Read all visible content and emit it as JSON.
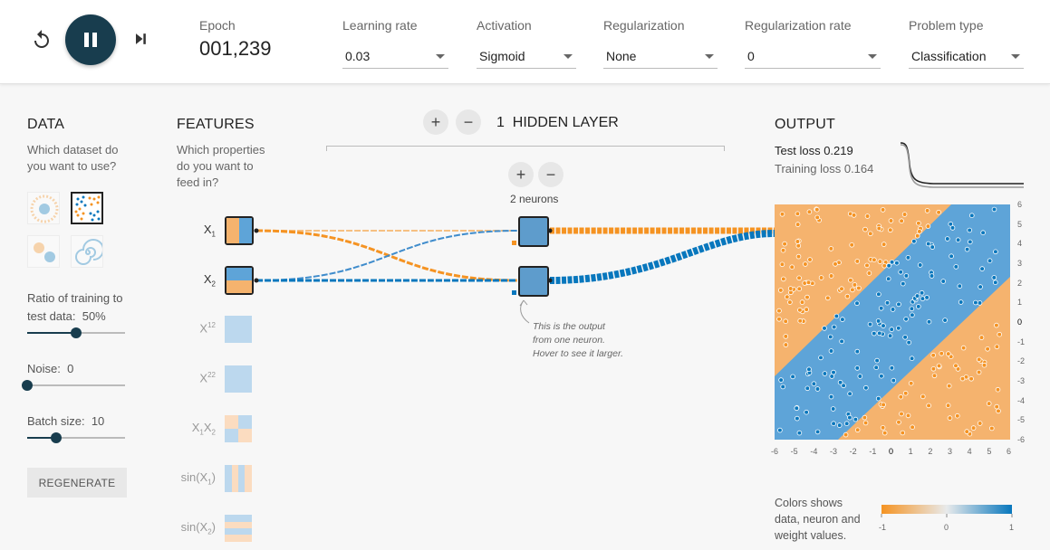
{
  "controls": {
    "reset_icon": "reset-icon",
    "pause_icon": "pause-icon",
    "step_icon": "step-forward-icon"
  },
  "epoch": {
    "label": "Epoch",
    "value": "001,239"
  },
  "dropdowns": [
    {
      "id": "learning-rate",
      "label": "Learning rate",
      "value": "0.03"
    },
    {
      "id": "activation",
      "label": "Activation",
      "value": "Sigmoid"
    },
    {
      "id": "regularization",
      "label": "Regularization",
      "value": "None"
    },
    {
      "id": "regularization-rate",
      "label": "Regularization rate",
      "value": "0"
    },
    {
      "id": "problem-type",
      "label": "Problem type",
      "value": "Classification"
    }
  ],
  "data_panel": {
    "title": "DATA",
    "subtitle_line1": "Which dataset do",
    "subtitle_line2": "you want to use?",
    "ratio_label_line1": "Ratio of training to",
    "ratio_label_line2": "test data:",
    "ratio_value": "50%",
    "ratio_fraction": 0.5,
    "noise_label": "Noise:",
    "noise_value": "0",
    "noise_fraction": 0,
    "batch_label": "Batch size:",
    "batch_value": "10",
    "batch_fraction": 0.3,
    "regenerate": "REGENERATE"
  },
  "features": {
    "title": "FEATURES",
    "subtitle_line1": "Which properties",
    "subtitle_line2": "do you want to",
    "subtitle_line3": "feed in?",
    "items": [
      {
        "base": "X",
        "sub": "1",
        "active": true
      },
      {
        "base": "X",
        "sub": "2",
        "active": true
      },
      {
        "base": "X",
        "sub": "12",
        "active": false
      },
      {
        "base": "X",
        "sub": "22",
        "active": false
      },
      {
        "base": "X",
        "sub": "1",
        "base2": "X",
        "sub2": "2",
        "active": false
      },
      {
        "base": "sin(X",
        "sub": "1",
        "tail": ")",
        "active": false
      },
      {
        "base": "sin(X",
        "sub": "2",
        "tail": ")",
        "active": false
      }
    ]
  },
  "network": {
    "plus": "+",
    "minus": "−",
    "layer_count": "1",
    "layer_word": "HIDDEN LAYER",
    "neurons_label": "2 neurons",
    "annotation": "This is the output from one neuron. Hover to see it larger."
  },
  "output": {
    "title": "OUTPUT",
    "test_loss_label": "Test loss",
    "test_loss_value": "0.219",
    "training_loss_label": "Training loss",
    "training_loss_value": "0.164",
    "x_ticks": [
      "-6",
      "-5",
      "-4",
      "-3",
      "-2",
      "-1",
      "0",
      "1",
      "2",
      "3",
      "4",
      "5",
      "6"
    ],
    "y_ticks": [
      "6",
      "5",
      "4",
      "3",
      "2",
      "1",
      "0",
      "-1",
      "-2",
      "-3",
      "-4",
      "-5",
      "-6"
    ],
    "legend_line1": "Colors shows",
    "legend_line2": "data, neuron and",
    "legend_line3": "weight values.",
    "legend_ticks": [
      "-1",
      "0",
      "1"
    ]
  },
  "colors": {
    "orange": "#f59322",
    "blue": "#0877bd",
    "light_orange": "#f5b36e",
    "light_blue": "#5ea4d8",
    "dark": "#183d4e"
  }
}
